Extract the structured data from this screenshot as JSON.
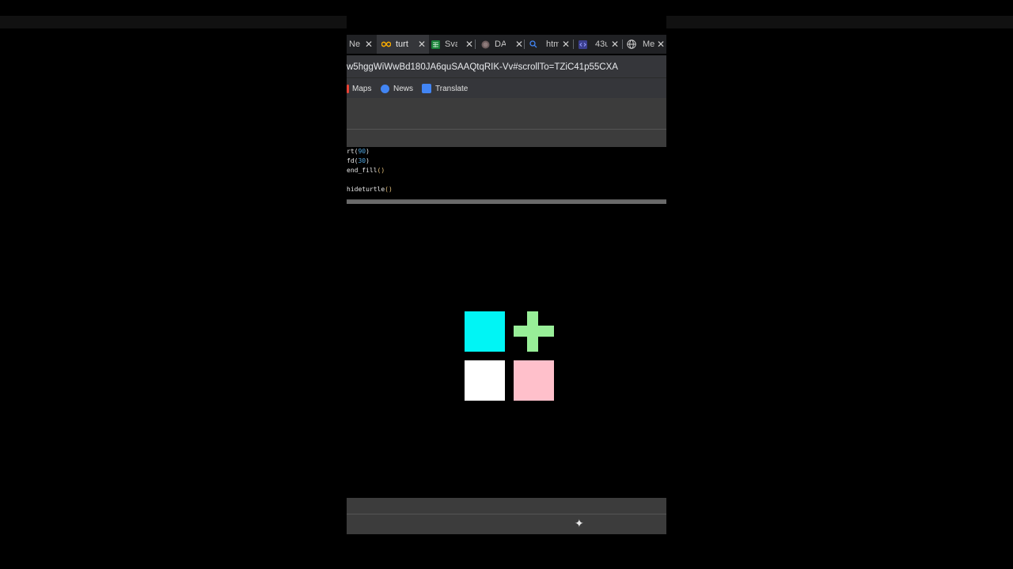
{
  "browser": {
    "tabs": [
      {
        "title": "Nev",
        "icon": "page-icon"
      },
      {
        "title": "turt",
        "icon": "infinity-icon",
        "active": true
      },
      {
        "title": "Sva",
        "icon": "sheets-icon"
      },
      {
        "title": "DA",
        "icon": "globe-icon"
      },
      {
        "title": "htm",
        "icon": "search-icon"
      },
      {
        "title": "43u",
        "icon": "code-icon"
      },
      {
        "title": "Mer",
        "icon": "globe-icon"
      }
    ],
    "close_glyph": "✕",
    "url": "w5hggWiWwBd180JA6quSAAQtqRIK-Vv#scrollTo=TZiC41p55CXA",
    "bookmarks": [
      {
        "label": "Maps",
        "icon": "maps-icon",
        "color": "#ea4335"
      },
      {
        "label": "News",
        "icon": "news-icon",
        "color": "#4285f4"
      },
      {
        "label": "Translate",
        "icon": "translate-icon",
        "color": "#4285f4"
      }
    ]
  },
  "code": {
    "line1": {
      "fn": "rt(",
      "num": "90",
      "end": ")"
    },
    "line2": {
      "fn": "fd(",
      "num": "30",
      "end": ")"
    },
    "line3": {
      "fn": "end_fill",
      "paren": "()"
    },
    "line4": {
      "fn": "hideturtle",
      "paren": "()"
    }
  },
  "canvas": {
    "shapes": [
      {
        "name": "cyan-square",
        "color": "#00f5f5"
      },
      {
        "name": "green-plus",
        "color": "#98ee98"
      },
      {
        "name": "white-square",
        "color": "#ffffff"
      },
      {
        "name": "pink-square",
        "color": "#ffc0cb"
      }
    ]
  },
  "footer": {
    "sparkle_glyph": "✦"
  }
}
